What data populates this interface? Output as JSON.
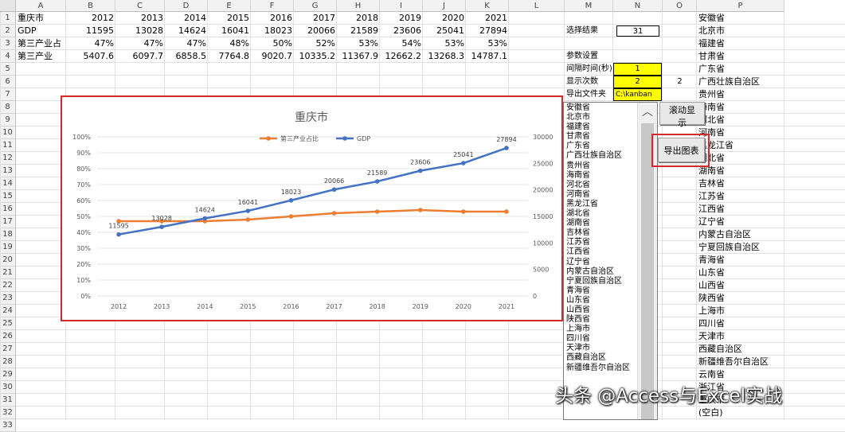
{
  "columns": [
    "A",
    "B",
    "C",
    "D",
    "E",
    "F",
    "G",
    "H",
    "I",
    "J",
    "K",
    "L",
    "M",
    "N",
    "O",
    "P"
  ],
  "rows": [
    "1",
    "2",
    "3",
    "4",
    "5",
    "6",
    "7",
    "8",
    "9",
    "10",
    "11",
    "12",
    "13",
    "14",
    "15",
    "16",
    "17",
    "18",
    "19",
    "20",
    "21",
    "22",
    "23",
    "24",
    "25",
    "26",
    "27",
    "28",
    "29",
    "30",
    "31",
    "32",
    "33"
  ],
  "table": {
    "header": {
      "label": "重庆市",
      "years": [
        "2012",
        "2013",
        "2014",
        "2015",
        "2016",
        "2017",
        "2018",
        "2019",
        "2020",
        "2021"
      ]
    },
    "rows": [
      {
        "label": "GDP",
        "values": [
          "11595",
          "13028",
          "14624",
          "16041",
          "18023",
          "20066",
          "21589",
          "23606",
          "25041",
          "27894"
        ]
      },
      {
        "label": "第三产业占",
        "values": [
          "47%",
          "47%",
          "47%",
          "48%",
          "50%",
          "52%",
          "53%",
          "54%",
          "53%",
          "53%"
        ]
      },
      {
        "label": "第三产业",
        "values": [
          "5407.6",
          "6097.7",
          "6858.5",
          "7764.8",
          "9020.7",
          "10335.2",
          "11367.9",
          "12662.2",
          "13268.3",
          "14787.1"
        ]
      }
    ]
  },
  "controls": {
    "result_label": "选择结果",
    "result_value": "31",
    "params_title": "参数设置",
    "interval_label": "间隔时间(秒)",
    "interval_value": "1",
    "count_label": "显示次数",
    "count_value": "2",
    "o6_value": "2",
    "folder_label": "导出文件夹",
    "folder_value": "C:\\kanban",
    "scroll_button": "滚动显示",
    "export_button": "导出图表"
  },
  "provinces_p": [
    "安徽省",
    "北京市",
    "福建省",
    "甘肃省",
    "广东省",
    "广西壮族自治区",
    "贵州省",
    "海南省",
    "河北省",
    "河南省",
    "黑龙江省",
    "湖北省",
    "湖南省",
    "吉林省",
    "江苏省",
    "江西省",
    "辽宁省",
    "内蒙古自治区",
    "宁夏回族自治区",
    "青海省",
    "山东省",
    "山西省",
    "陕西省",
    "上海市",
    "四川省",
    "天津市",
    "西藏自治区",
    "新疆维吾尔自治区",
    "云南省",
    "浙江省",
    "重庆市",
    "(空白)"
  ],
  "listbox_items": [
    "安徽省",
    "北京市",
    "福建省",
    "甘肃省",
    "广东省",
    "广西壮族自治区",
    "贵州省",
    "海南省",
    "河北省",
    "河南省",
    "黑龙江省",
    "湖北省",
    "湖南省",
    "吉林省",
    "江苏省",
    "江西省",
    "辽宁省",
    "内蒙古自治区",
    "宁夏回族自治区",
    "青海省",
    "山东省",
    "山西省",
    "陕西省",
    "上海市",
    "四川省",
    "天津市",
    "西藏自治区",
    "新疆维吾尔自治区"
  ],
  "listbox_scroll_up": "︿",
  "chart_data": {
    "type": "line",
    "title": "重庆市",
    "categories": [
      "2012",
      "2013",
      "2014",
      "2015",
      "2016",
      "2017",
      "2018",
      "2019",
      "2020",
      "2021"
    ],
    "series": [
      {
        "name": "第三产业占比",
        "axis": "left",
        "values": [
          0.47,
          0.47,
          0.47,
          0.48,
          0.5,
          0.52,
          0.53,
          0.54,
          0.53,
          0.53
        ],
        "color": "#ed7d31"
      },
      {
        "name": "GDP",
        "axis": "right",
        "values": [
          11595,
          13028,
          14624,
          16041,
          18023,
          20066,
          21589,
          23606,
          25041,
          27894
        ],
        "color": "#4472c4",
        "data_labels": true
      }
    ],
    "left_ticks": [
      "0%",
      "10%",
      "20%",
      "30%",
      "40%",
      "50%",
      "60%",
      "70%",
      "80%",
      "90%",
      "100%"
    ],
    "right_ticks": [
      "0",
      "5000",
      "10000",
      "15000",
      "20000",
      "25000",
      "30000"
    ],
    "ylim_left": [
      0,
      1
    ],
    "ylim_right": [
      0,
      30000
    ],
    "legend": "top-center",
    "grid": true
  },
  "watermark": "头条 @Access与Excel实战",
  "colors": {
    "accent_red": "#d42a2a",
    "yellow": "#ffff00",
    "selection": "#217346"
  }
}
